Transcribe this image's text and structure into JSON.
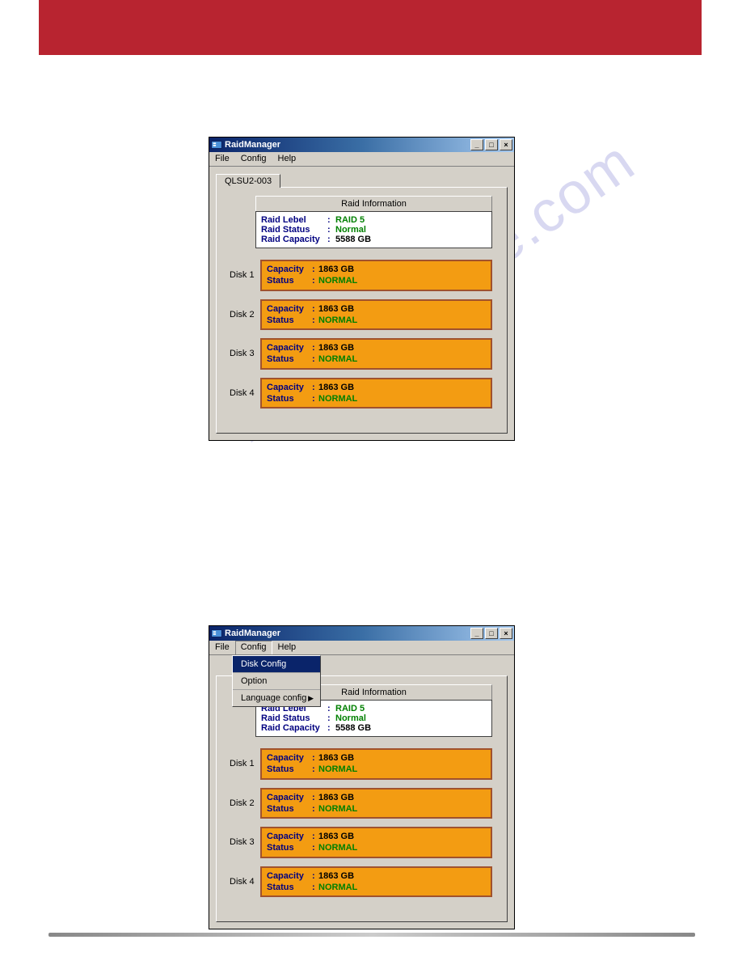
{
  "app": {
    "title": "RaidManager",
    "menus": [
      "File",
      "Config",
      "Help"
    ],
    "titlebar_buttons": {
      "min": "_",
      "max": "□",
      "close": "×"
    }
  },
  "tab": {
    "label": "QLSU2-003"
  },
  "raid_info": {
    "header": "Raid Information",
    "level_label": "Raid Lebel",
    "level_value": "RAID 5",
    "status_label": "Raid Status",
    "status_value": "Normal",
    "capacity_label": "Raid Capacity",
    "capacity_value": "5588 GB"
  },
  "disks": [
    {
      "label": "Disk 1",
      "capacity_label": "Capacity",
      "capacity_value": "1863 GB",
      "status_label": "Status",
      "status_value": "NORMAL"
    },
    {
      "label": "Disk 2",
      "capacity_label": "Capacity",
      "capacity_value": "1863 GB",
      "status_label": "Status",
      "status_value": "NORMAL"
    },
    {
      "label": "Disk 3",
      "capacity_label": "Capacity",
      "capacity_value": "1863 GB",
      "status_label": "Status",
      "status_value": "NORMAL"
    },
    {
      "label": "Disk 4",
      "capacity_label": "Capacity",
      "capacity_value": "1863 GB",
      "status_label": "Status",
      "status_value": "NORMAL"
    }
  ],
  "config_menu": {
    "items": [
      "Disk Config",
      "Option",
      "Language config"
    ]
  },
  "watermark": "manualshive.com"
}
